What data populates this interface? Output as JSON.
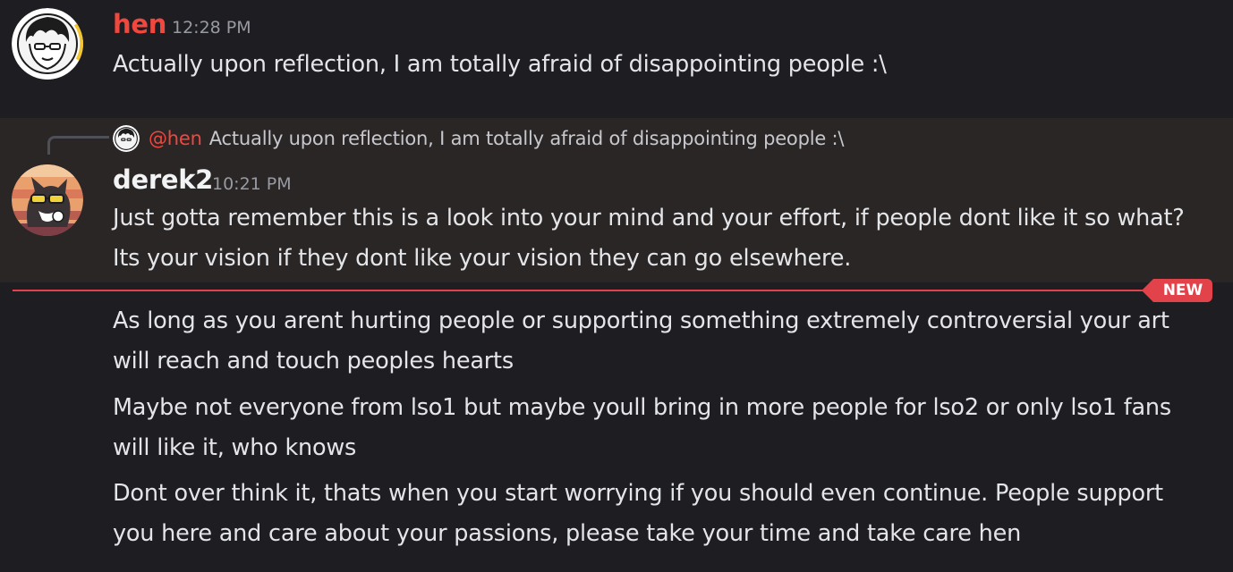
{
  "messages": [
    {
      "username": "hen",
      "timestamp": "12:28 PM",
      "text": "Actually upon reflection, I am totally afraid of disappointing people :\\",
      "avatar_icon": "manga-boy-avatar-icon"
    },
    {
      "username": "derek2",
      "timestamp": "10:21 PM",
      "reply": {
        "mention": "@hen",
        "text": "Actually upon reflection, I am totally afraid of disappointing people :\\"
      },
      "text": "Just gotta remember this is a look into your mind and your effort, if people dont like it so what? Its your vision if they dont like your vision they can go elsewhere.",
      "avatar_icon": "cat-sunglasses-avatar-icon"
    }
  ],
  "divider": {
    "label": "NEW"
  },
  "followups": [
    "As long as you arent hurting people or supporting something extremely controversial your art will reach and touch peoples hearts",
    "Maybe not everyone from lso1 but maybe youll bring in more people for lso2 or only lso1 fans will like it, who knows",
    "Dont over think it, thats when you start worrying if you should even continue. People support you here and care about your passions, please take your time and take care hen"
  ],
  "colors": {
    "background": "#1e1e22",
    "highlight": "#2a2625",
    "hen_name": "#f0473f",
    "new_divider": "#e2434b"
  }
}
